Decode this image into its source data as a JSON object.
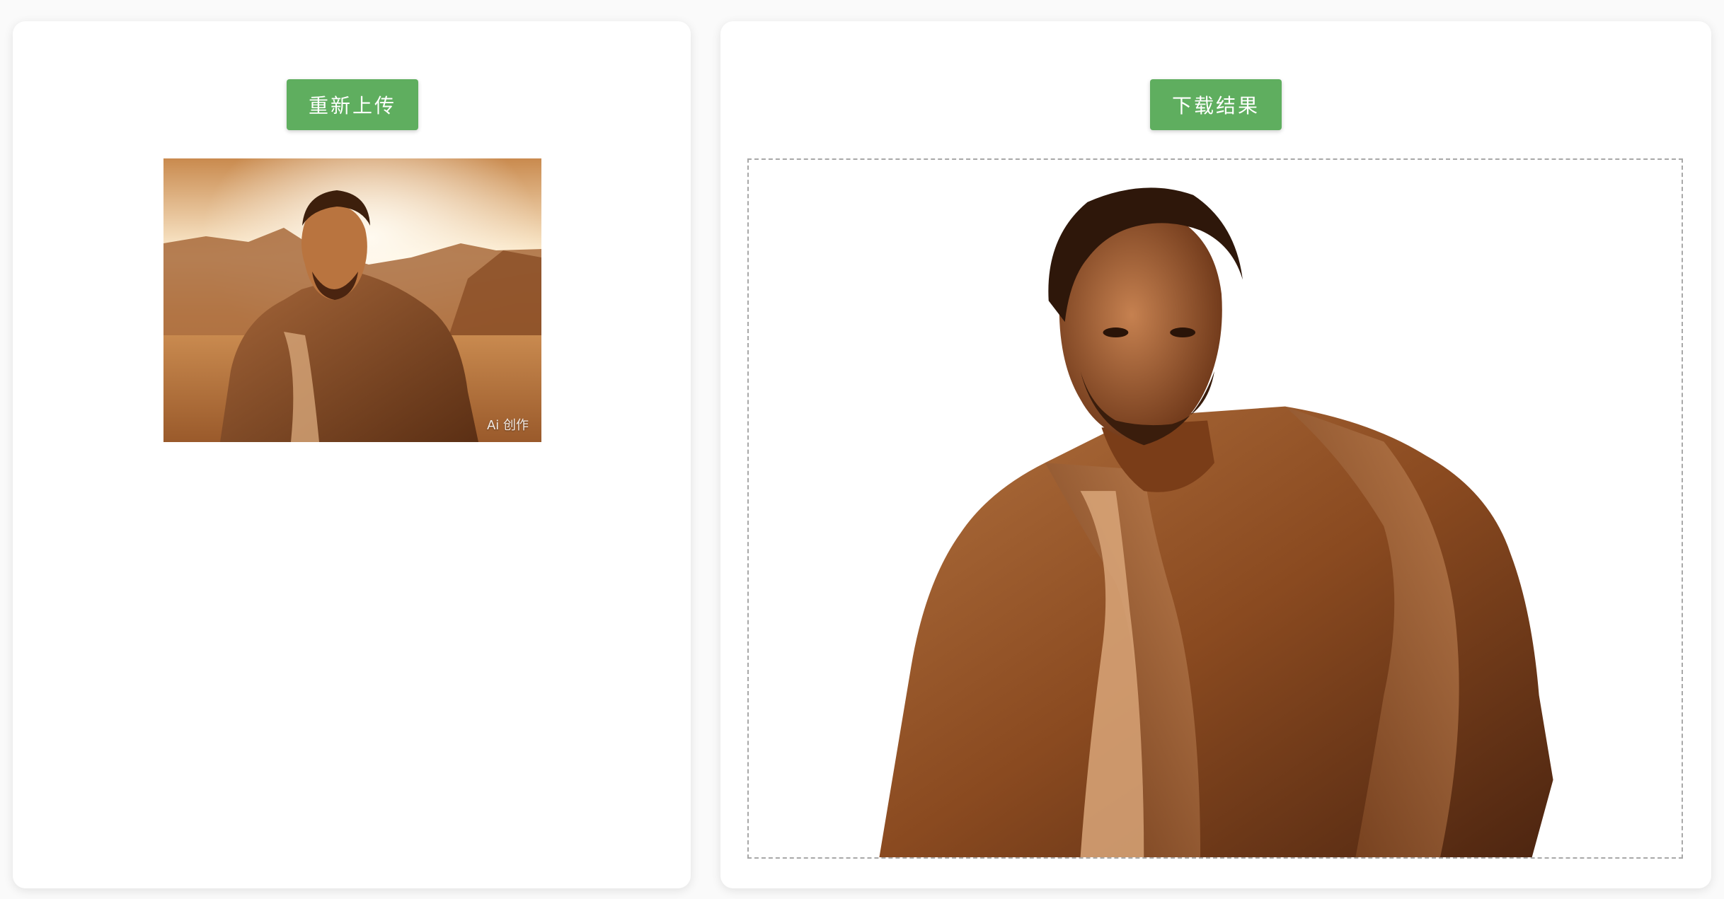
{
  "left_panel": {
    "reupload_button": "重新上传",
    "thumbnail_watermark": "Ai 创作"
  },
  "right_panel": {
    "download_button": "下载结果"
  },
  "colors": {
    "button_green": "#5fae5f",
    "frame_border": "#a8a8a8",
    "sepia_dark": "#5a2e12",
    "sepia_mid": "#9c5a2a",
    "sepia_light": "#e8b985"
  }
}
